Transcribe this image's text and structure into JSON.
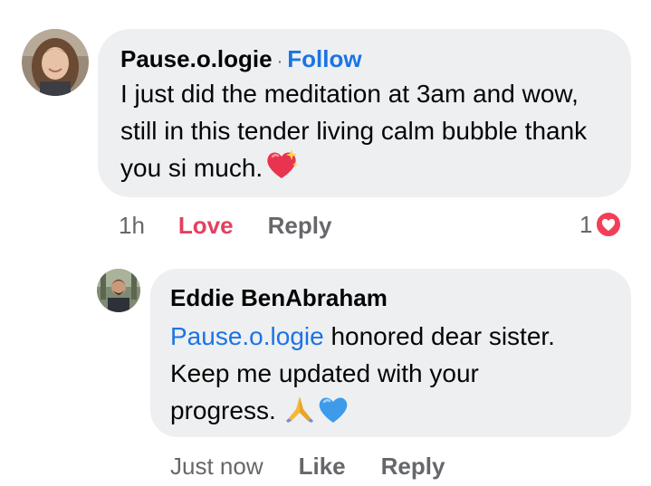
{
  "comment": {
    "author": "Pause.o.logie",
    "separator": "·",
    "follow_label": "Follow",
    "text": "I just did the meditation at 3am and wow, still in this tender living calm bubble thank you si much.",
    "text_emoji": "sparkling-heart",
    "timestamp": "1h",
    "love_label": "Love",
    "reply_label": "Reply",
    "reaction_count": "1",
    "reaction_icon": "love-reaction-icon",
    "colors": {
      "love": "#e4405f",
      "link": "#1b74e4",
      "bubble": "#eeeff1",
      "meta": "#65676b"
    }
  },
  "reply": {
    "author": "Eddie BenAbraham",
    "mention": "Pause.o.logie",
    "text": " honored dear sister. Keep me updated with your progress. ",
    "text_emojis": [
      "folded-hands",
      "blue-heart"
    ],
    "timestamp": "Just now",
    "like_label": "Like",
    "reply_label": "Reply"
  }
}
